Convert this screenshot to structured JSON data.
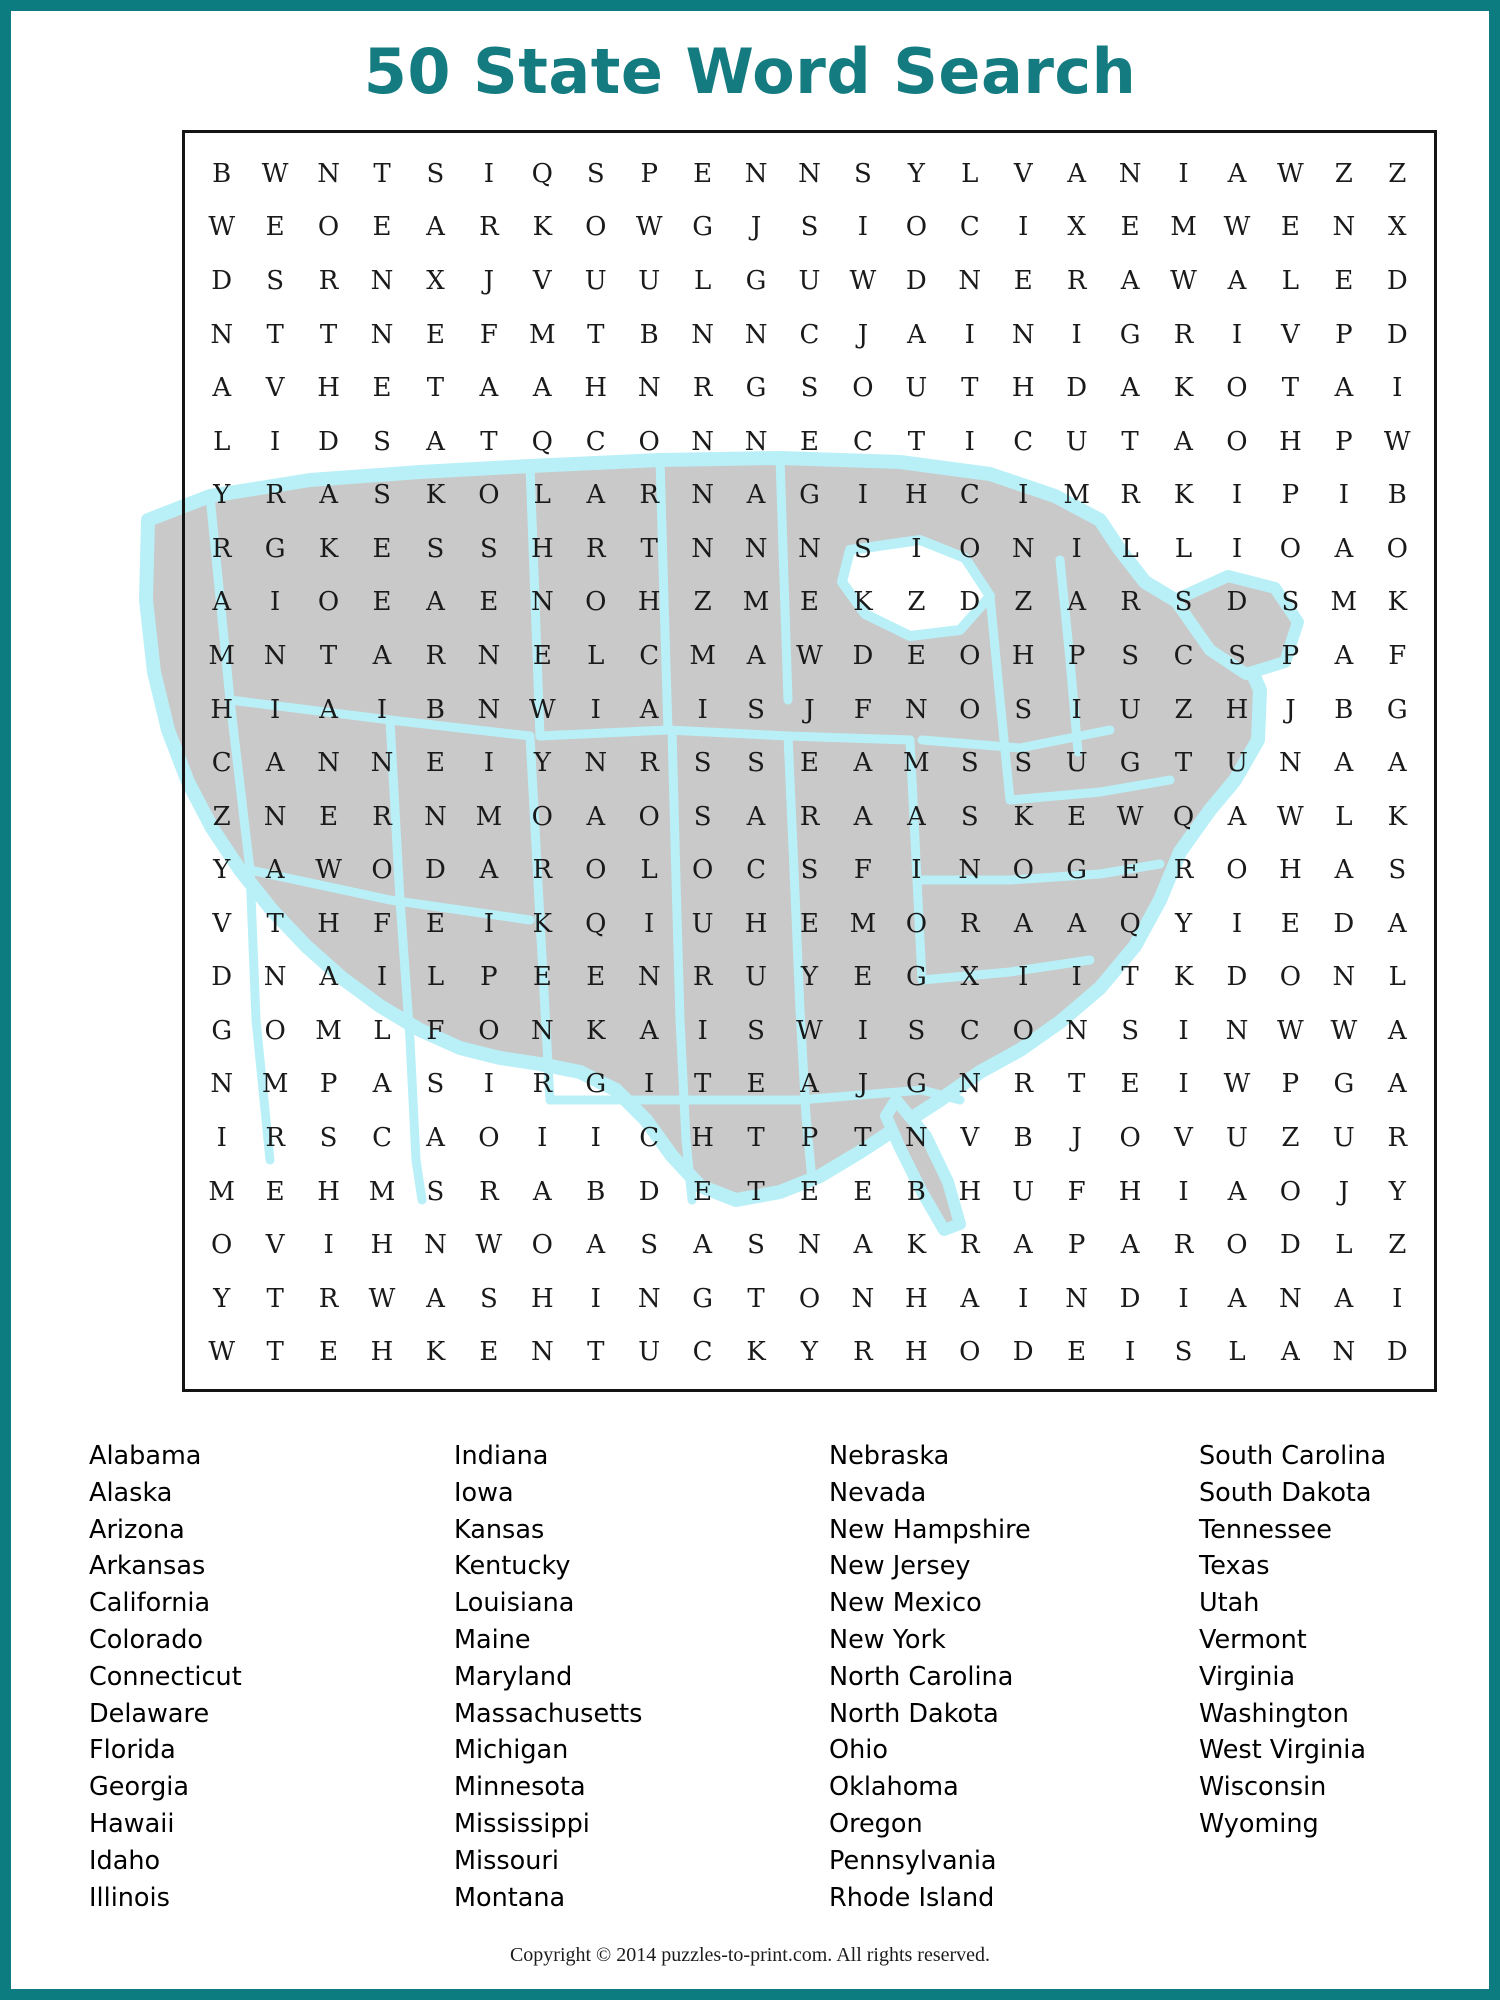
{
  "page": {
    "title": "50 State Word Search",
    "border_color": "#0d7c80",
    "title_color": "#147b80",
    "footer": "Copyright © 2014 puzzles-to-print.com. All rights reserved."
  },
  "puzzle": {
    "columns": 23,
    "rows": 24,
    "map_fill": "#c9c9c9",
    "map_outline": "#b9f0f7",
    "rows_text": [
      "BWNTSIQSPENNSYLVANIAWZZ",
      "WEOEARKOWGJSIOCIXEMWENX",
      "DSRNXJVUULGUWDNERAWALED",
      "NTTNEFMTBNNCJAINIGRIVPD",
      "AVHETAAHNRGSOUTHDAKOTAI",
      "LIDSATQCONNECTICUTAOHPW",
      "YRASKOLARNAGIHCIMRKIPIB",
      "RGKESSHRTNNNSIONILLIOAO",
      "AIOEAENOHZMEKZDZARSDSMK",
      "MNTARNELCMAWDEOHPSCSPAF",
      "HIAIBNWIAISJFNOSIUZHJBG",
      "CANNEIYNRSSEAMSSUGTUNAA",
      "ZNERNMOAOSARAASKEWQAWLK",
      "YAWODAROLOCSFINOGEROHAS",
      "VTHFEIKQIUHEMORAAQYIEDA",
      "DNAILPEENRUYEGXIITKDONL",
      "GOMLFONKAISWISCONSINWWA",
      "NMPASIRGITEAJGNRTEIWPGA",
      "IRSCAOIICHTPTNVBJOVUZUR",
      "MEHMSRABDETEEBHUFHIAOJY",
      "OVIHNWOASASNAKRAPARODLZ",
      "YTRWASHINGTONHAINDIANAI",
      "WTEHKENTUCKYRHODEISLAND"
    ]
  },
  "word_list": {
    "columns": [
      {
        "words": [
          "Alabama",
          "Alaska",
          "Arizona",
          "Arkansas",
          "California",
          "Colorado",
          "Connecticut",
          "Delaware",
          "Florida",
          "Georgia",
          "Hawaii",
          "Idaho",
          "Illinois"
        ]
      },
      {
        "words": [
          "Indiana",
          "Iowa",
          "Kansas",
          "Kentucky",
          "Louisiana",
          "Maine",
          "Maryland",
          "Massachusetts",
          "Michigan",
          "Minnesota",
          "Mississippi",
          "Missouri",
          "Montana"
        ]
      },
      {
        "words": [
          "Nebraska",
          "Nevada",
          "New Hampshire",
          "New Jersey",
          "New Mexico",
          "New York",
          "North Carolina",
          "North Dakota",
          "Ohio",
          "Oklahoma",
          "Oregon",
          "Pennsylvania",
          "Rhode Island"
        ]
      },
      {
        "words": [
          "South Carolina",
          "South Dakota",
          "Tennessee",
          "Texas",
          "Utah",
          "Vermont",
          "Virginia",
          "Washington",
          "West Virginia",
          "Wisconsin",
          "Wyoming"
        ]
      }
    ]
  }
}
